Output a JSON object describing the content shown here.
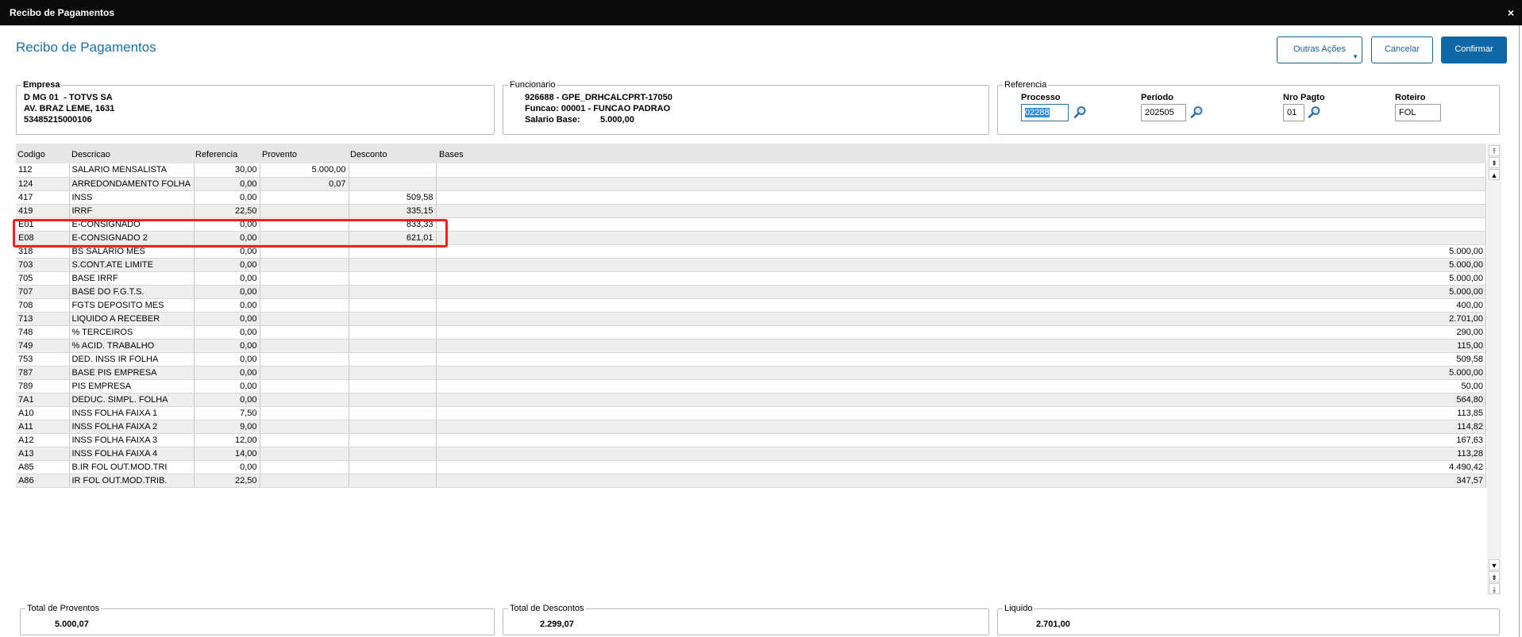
{
  "window": {
    "title": "Recibo de Pagamentos",
    "close_glyph": "×"
  },
  "page_title": "Recibo de Pagamentos",
  "actions": {
    "outras": "Outras Ações",
    "cancelar": "Cancelar",
    "confirmar": "Confirmar"
  },
  "empresa": {
    "legend": "Empresa",
    "line1": "D MG 01  - TOTVS SA",
    "line2": "AV. BRAZ LEME, 1631",
    "line3": "53485215000106"
  },
  "funcionario": {
    "legend": "Funcionario",
    "line1": "926688 - GPE_DRHCALCPRT-17050",
    "line2": "Funcao: 00001 - FUNCAO PADRAO",
    "salario_label": "Salario Base:",
    "salario_value": "5.000,00"
  },
  "referencia": {
    "legend": "Referencia",
    "processo_label": "Processo",
    "processo_value": "02288",
    "periodo_label": "Período",
    "periodo_value": "202505",
    "nro_label": "Nro Pagto",
    "nro_value": "01",
    "roteiro_label": "Roteiro",
    "roteiro_value": "FOL"
  },
  "grid": {
    "columns": [
      "Codigo",
      "Descricao",
      "Referencia",
      "Provento",
      "Desconto",
      "Bases"
    ],
    "rows": [
      [
        "112",
        "SALARIO MENSALISTA",
        "30,00",
        "5.000,00",
        "",
        ""
      ],
      [
        "124",
        "ARREDONDAMENTO FOLHA",
        "0,00",
        "0,07",
        "",
        ""
      ],
      [
        "417",
        "INSS",
        "0,00",
        "",
        "509,58",
        ""
      ],
      [
        "419",
        "IRRF",
        "22,50",
        "",
        "335,15",
        ""
      ],
      [
        "E01",
        "E-CONSIGNADO",
        "0,00",
        "",
        "833,33",
        ""
      ],
      [
        "E08",
        "E-CONSIGNADO 2",
        "0,00",
        "",
        "621,01",
        ""
      ],
      [
        "318",
        "BS SALARIO MES",
        "0,00",
        "",
        "",
        "5.000,00"
      ],
      [
        "703",
        "S.CONT.ATE LIMITE",
        "0,00",
        "",
        "",
        "5.000,00"
      ],
      [
        "705",
        "BASE IRRF",
        "0,00",
        "",
        "",
        "5.000,00"
      ],
      [
        "707",
        "BASE DO F.G.T.S.",
        "0,00",
        "",
        "",
        "5.000,00"
      ],
      [
        "708",
        "FGTS DEPOSITO MES",
        "0,00",
        "",
        "",
        "400,00"
      ],
      [
        "713",
        "LIQUIDO A RECEBER",
        "0,00",
        "",
        "",
        "2.701,00"
      ],
      [
        "748",
        "% TERCEIROS",
        "0,00",
        "",
        "",
        "290,00"
      ],
      [
        "749",
        "% ACID. TRABALHO",
        "0,00",
        "",
        "",
        "115,00"
      ],
      [
        "753",
        "DED. INSS IR FOLHA",
        "0,00",
        "",
        "",
        "509,58"
      ],
      [
        "787",
        "BASE PIS EMPRESA",
        "0,00",
        "",
        "",
        "5.000,00"
      ],
      [
        "789",
        "PIS EMPRESA",
        "0,00",
        "",
        "",
        "50,00"
      ],
      [
        "7A1",
        "DEDUC. SIMPL. FOLHA",
        "0,00",
        "",
        "",
        "564,80"
      ],
      [
        "A10",
        "INSS FOLHA FAIXA 1",
        "7,50",
        "",
        "",
        "113,85"
      ],
      [
        "A11",
        "INSS FOLHA FAIXA 2",
        "9,00",
        "",
        "",
        "114,82"
      ],
      [
        "A12",
        "INSS FOLHA FAIXA 3",
        "12,00",
        "",
        "",
        "167,63"
      ],
      [
        "A13",
        "INSS FOLHA FAIXA 4",
        "14,00",
        "",
        "",
        "113,28"
      ],
      [
        "A85",
        "B.IR FOL OUT.MOD.TRI",
        "0,00",
        "",
        "",
        "4.490,42"
      ],
      [
        "A86",
        "IR FOL OUT.MOD.TRIB.",
        "22,50",
        "",
        "",
        "347,57"
      ]
    ]
  },
  "totais": {
    "proventos_label": "Total de Proventos",
    "proventos_value": "5.000,07",
    "descontos_label": "Total de Descontos",
    "descontos_value": "2.299,07",
    "liquido_label": "Liquido",
    "liquido_value": "2.701,00"
  },
  "icons": {
    "lookup": "magnifier-icon",
    "close": "close-icon"
  },
  "colors": {
    "accent": "#1a6fa6",
    "primary_button": "#0f67a6",
    "highlight": "#ff1c1c",
    "titlebar": "#0b0b0b"
  }
}
